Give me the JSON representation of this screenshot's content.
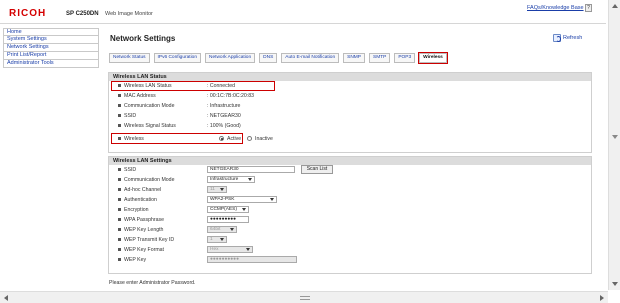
{
  "header": {
    "logo": "RICOH",
    "model": "SP C250DN",
    "subtitle": "Web Image Monitor",
    "faq_link": "FAQs/Knowledge Base",
    "help_label": "?"
  },
  "sidebar": {
    "items": [
      {
        "label": "Home"
      },
      {
        "label": "System Settings"
      },
      {
        "label": "Network Settings"
      },
      {
        "label": "Print List/Report"
      },
      {
        "label": "Administrator Tools"
      }
    ]
  },
  "main": {
    "title": "Network Settings",
    "refresh_label": "Refresh",
    "tabs": [
      {
        "label": "Network Status"
      },
      {
        "label": "IPv6 Configuration"
      },
      {
        "label": "Network Application"
      },
      {
        "label": "DNS"
      },
      {
        "label": "Auto E-mail Notification"
      },
      {
        "label": "SNMP"
      },
      {
        "label": "SMTP"
      },
      {
        "label": "POP3"
      },
      {
        "label": "Wireless"
      }
    ]
  },
  "status_section": {
    "heading": "Wireless LAN Status",
    "rows": [
      {
        "label": "Wireless LAN Status",
        "value": ": Connected"
      },
      {
        "label": "MAC Address",
        "value": ": 00:1C:7B:0C:20:83"
      },
      {
        "label": "Communication Mode",
        "value": ": Infrastructure"
      },
      {
        "label": "SSID",
        "value": ": NETGEAR30"
      },
      {
        "label": "Wireless Signal Status",
        "value": ": 100% (Good)"
      }
    ],
    "wireless": {
      "label": "Wireless",
      "active_label": "Active",
      "inactive_label": "Inactive"
    }
  },
  "settings_section": {
    "heading": "Wireless LAN Settings",
    "ssid": {
      "label": "SSID",
      "value": "NETGEAR30",
      "scan_button": "Scan List"
    },
    "comm_mode": {
      "label": "Communication Mode",
      "value": "Infrastructure"
    },
    "adhoc_channel": {
      "label": "Ad-hoc Channel",
      "value": "11"
    },
    "authentication": {
      "label": "Authentication",
      "value": "WPA2-PSK"
    },
    "encryption": {
      "label": "Encryption",
      "value": "CCMP(AES)"
    },
    "wpa_passphrase": {
      "label": "WPA Passphrase",
      "value": "●●●●●●●●●"
    },
    "wep_key_length": {
      "label": "WEP Key Length",
      "value": "64bit"
    },
    "wep_transmit_id": {
      "label": "WEP Transmit Key ID",
      "value": "1"
    },
    "wep_key_format": {
      "label": "WEP Key Format",
      "value": "Hex"
    },
    "wep_key": {
      "label": "WEP Key",
      "value": "●●●●●●●●●●"
    }
  },
  "footer": {
    "note": "Please enter Administrator Password."
  }
}
